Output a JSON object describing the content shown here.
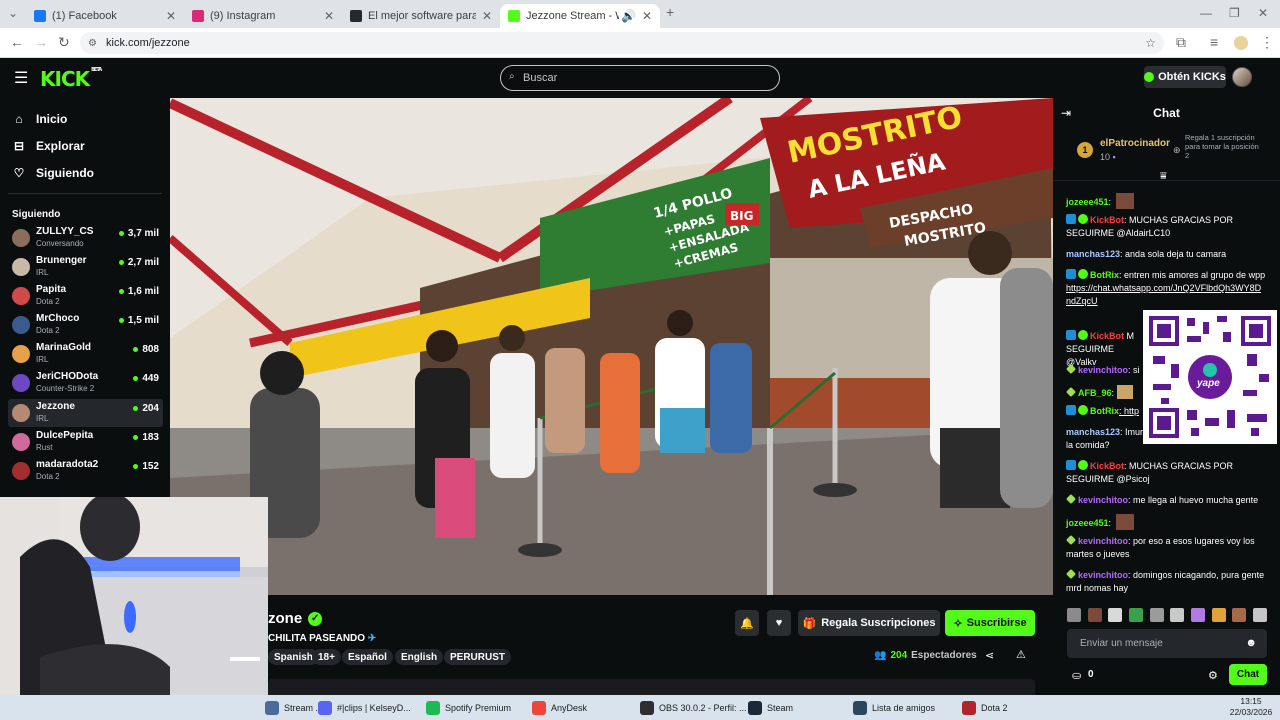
{
  "browser": {
    "tabs": [
      {
        "title": "(1) Facebook",
        "icon": "facebook-icon",
        "color": "#1877f2"
      },
      {
        "title": "(9) Instagram",
        "icon": "instagram-icon",
        "color": "#d62976"
      },
      {
        "title": "El mejor software para potenciar",
        "icon": "github-icon",
        "color": "#24292f"
      },
      {
        "title": "Jezzone Stream - Watch Live",
        "icon": "kick-icon",
        "color": "#53fc18"
      }
    ],
    "url": "kick.com/jezzone",
    "new_tab": "+"
  },
  "header": {
    "logo": "KICK",
    "logo_badge": "BETA",
    "search_placeholder": "Buscar",
    "kicks_button": "Obtén KICKs"
  },
  "sidebar": {
    "nav": [
      {
        "label": "Inicio",
        "icon": "home-icon",
        "glyph": "⌂"
      },
      {
        "label": "Explorar",
        "icon": "compass-icon",
        "glyph": "⊟"
      },
      {
        "label": "Siguiendo",
        "icon": "heart-icon",
        "glyph": "♡"
      }
    ],
    "following_title": "Siguiendo",
    "channels": [
      {
        "name": "ZULLYY_CS",
        "category": "Conversando",
        "viewers": "3,7 mil",
        "color": "#8a6d5a"
      },
      {
        "name": "Brunenger",
        "category": "IRL",
        "viewers": "2,7 mil",
        "color": "#c9b8a6"
      },
      {
        "name": "Papita",
        "category": "Dota 2",
        "viewers": "1,6 mil",
        "color": "#d04a4a"
      },
      {
        "name": "MrChoco",
        "category": "Dota 2",
        "viewers": "1,5 mil",
        "color": "#3b5b8f"
      },
      {
        "name": "MarinaGold",
        "category": "IRL",
        "viewers": "808",
        "color": "#e6a14a"
      },
      {
        "name": "JeriCHODota",
        "category": "Counter-Strike 2",
        "viewers": "449",
        "color": "#6a49c2"
      },
      {
        "name": "Jezzone",
        "category": "IRL",
        "viewers": "204",
        "color": "#b48a74"
      },
      {
        "name": "DulcePepita",
        "category": "Rust",
        "viewers": "183",
        "color": "#cf6b9a"
      },
      {
        "name": "madaradota2",
        "category": "Dota 2",
        "viewers": "152",
        "color": "#a22e2e"
      }
    ]
  },
  "stream": {
    "title_fragment": "zone",
    "subtitle": "CHILITA PASEANDO",
    "tags": [
      "Spanish",
      "18+",
      "Español",
      "English",
      "PERURUST"
    ],
    "gift_button": "Regala Suscripciones",
    "subscribe_button": "Suscribirse",
    "viewers_count": "204",
    "viewers_label": "Espectadores"
  },
  "video": {
    "sign_main": "MOSTRITO",
    "sign_sub": "A LA LEÑA",
    "sign_promo_1": "1/4 POLLO",
    "sign_promo_2": "+PAPAS",
    "sign_promo_3": "+ENSALADA",
    "sign_promo_4": "+CREMAS",
    "sign_big": "BIG",
    "sign_despacho": "DESPACHO",
    "sign_mostrito": "MOSTRITO"
  },
  "chat": {
    "title": "Chat",
    "sponsor": {
      "rank": "1",
      "name": "elPatrocinador",
      "count": "10",
      "promo": "Regala 1 suscripción para tomar la posición 2"
    },
    "messages": [
      {
        "user": "jozeee451",
        "text": ":",
        "style": "u-green"
      },
      {
        "user": "KickBot",
        "text": ": MUCHAS GRACIAS POR SEGUIRME @AldairLC10",
        "style": "u-red",
        "badges": true
      },
      {
        "user": "manchas123",
        "text": ": anda sola deja tu camara",
        "style": "u-lblue"
      },
      {
        "user": "BotRix",
        "text": ": entren mis amores al grupo de wpp",
        "style": "u-green",
        "badges": true,
        "link": "https://chat.whatsapp.com/JnQ2VFlbdQh3WY8DndZqcU"
      },
      {
        "user": "KickBot",
        "text": ": M... SEGUIRME @Valkv",
        "style": "u-red",
        "badges": true
      },
      {
        "user": "kevinchitoo",
        "text": ": si",
        "style": "u-purple",
        "gem": true
      },
      {
        "user": "AFB_96",
        "text": ":",
        "style": "u-green",
        "gem": true
      },
      {
        "user": "BotRix",
        "text": ": http",
        "style": "u-green",
        "badges": true
      },
      {
        "user": "manchas123",
        "text": ": Imur... la comida?",
        "style": "u-lblue"
      },
      {
        "user": "KickBot",
        "text": ": MUCHAS GRACIAS POR SEGUIRME @Psicoj",
        "style": "u-red",
        "badges": true
      },
      {
        "user": "kevinchitoo",
        "text": ": me llega al huevo mucha gente",
        "style": "u-purple",
        "gem": true
      },
      {
        "user": "jozeee451",
        "text": ":",
        "style": "u-green"
      },
      {
        "user": "kevinchitoo",
        "text": ": por eso a esos lugares voy los martes o jueves",
        "style": "u-purple",
        "gem": true
      },
      {
        "user": "kevinchitoo",
        "text": ": domingos nicagando, pura gente mrd nomas hay",
        "style": "u-purple",
        "gem": true
      }
    ],
    "qr_label": "yape",
    "input_placeholder": "Enviar un mensaje",
    "points": "0",
    "send_button": "Chat"
  },
  "taskbar": {
    "items": [
      {
        "label": "Stream ...",
        "color": "#4a6a9a"
      },
      {
        "label": "#|clips | KelseyD...",
        "color": "#5865f2"
      },
      {
        "label": "Spotify Premium",
        "color": "#1db954"
      },
      {
        "label": "AnyDesk",
        "color": "#ef443b"
      },
      {
        "label": "OBS 30.0.2 - Perfil: ...",
        "color": "#302e31"
      },
      {
        "label": "Steam",
        "color": "#1b2838"
      },
      {
        "label": "Lista de amigos",
        "color": "#2a475e"
      },
      {
        "label": "Dota 2",
        "color": "#b0242b"
      }
    ],
    "time": "13:15",
    "date": "22/03/2026"
  }
}
